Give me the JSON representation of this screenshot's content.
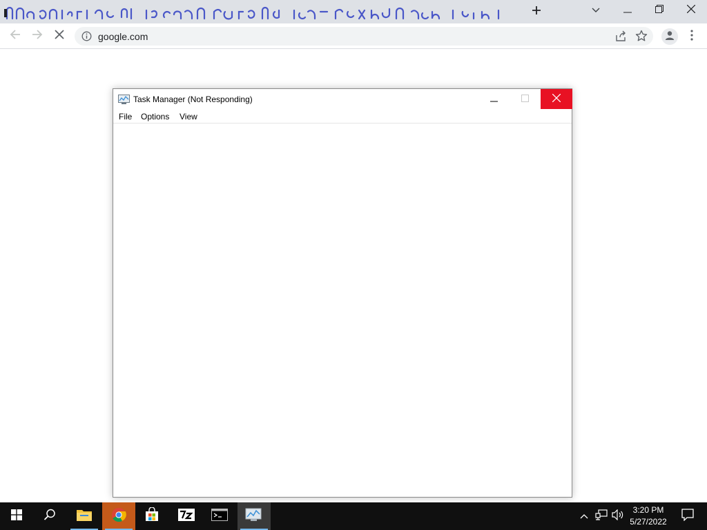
{
  "browser": {
    "url": "google.com",
    "tab_search_icon": "chevron-down-icon",
    "new_tab_icon": "plus-icon"
  },
  "task_manager": {
    "title": "Task Manager (Not Responding)",
    "menu": [
      "File",
      "Options",
      "View"
    ],
    "close_color": "#e81123"
  },
  "taskbar": {
    "apps": [
      "start",
      "search",
      "file-explorer",
      "chrome",
      "microsoft-store",
      "7-zip",
      "command-prompt",
      "task-manager"
    ],
    "time": "3:20 PM",
    "date": "5/27/2022"
  }
}
